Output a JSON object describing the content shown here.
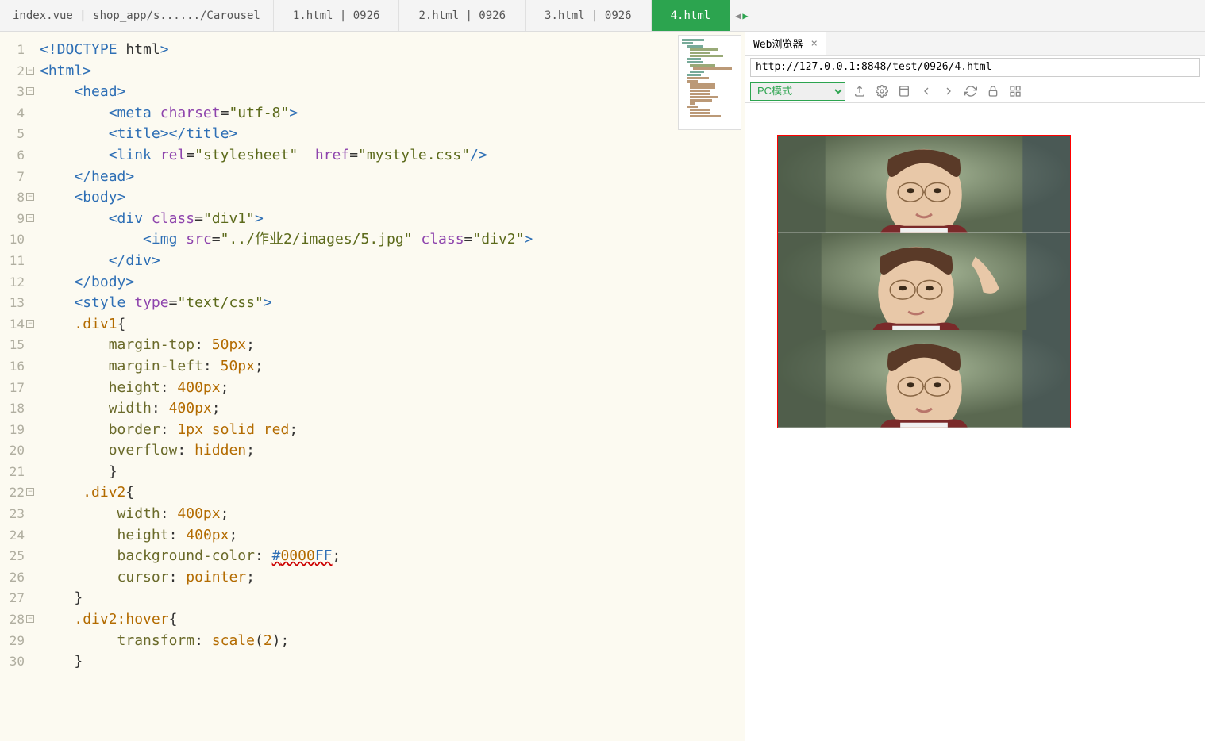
{
  "tabs": [
    "index.vue | shop_app/s....../Carousel",
    "1.html | 0926",
    "2.html | 0926",
    "3.html | 0926",
    "4.html"
  ],
  "active_tab": 4,
  "browser": {
    "tab_label": "Web浏览器",
    "url": "http://127.0.0.1:8848/test/0926/4.html",
    "mode": "PC模式"
  },
  "code": {
    "lines": [
      {
        "num": 1,
        "fold": false,
        "segs": [
          [
            "ctag",
            "<!DOCTYPE"
          ],
          [
            "",
            ""
          ],
          [
            "",
            ""
          ],
          [
            "",
            ""
          ],
          [
            "",
            ""
          ]
        ],
        "raw": "<!DOCTYPE html>"
      },
      {
        "num": 2,
        "fold": true,
        "raw": "<html>"
      },
      {
        "num": 3,
        "fold": true,
        "raw": "    <head>"
      },
      {
        "num": 4,
        "fold": false,
        "raw": "        <meta charset=\"utf-8\">"
      },
      {
        "num": 5,
        "fold": false,
        "raw": "        <title></title>"
      },
      {
        "num": 6,
        "fold": false,
        "raw": "        <link rel=\"stylesheet\"  href=\"mystyle.css\"/>"
      },
      {
        "num": 7,
        "fold": false,
        "raw": "    </head>"
      },
      {
        "num": 8,
        "fold": true,
        "raw": "    <body>"
      },
      {
        "num": 9,
        "fold": true,
        "raw": "        <div class=\"div1\">"
      },
      {
        "num": 10,
        "fold": false,
        "raw": "            <img src=\"../作业2/images/5.jpg\" class=\"div2\">"
      },
      {
        "num": 11,
        "fold": false,
        "raw": "        </div>"
      },
      {
        "num": 12,
        "fold": false,
        "raw": "    </body>"
      },
      {
        "num": 13,
        "fold": false,
        "raw": "    <style type=\"text/css\">"
      },
      {
        "num": 14,
        "fold": true,
        "raw": "    .div1{"
      },
      {
        "num": 15,
        "fold": false,
        "raw": "        margin-top: 50px;"
      },
      {
        "num": 16,
        "fold": false,
        "raw": "        margin-left: 50px;"
      },
      {
        "num": 17,
        "fold": false,
        "raw": "        height:400px;"
      },
      {
        "num": 18,
        "fold": false,
        "raw": "        width: 400px;"
      },
      {
        "num": 19,
        "fold": false,
        "raw": "        border: 1px solid red;"
      },
      {
        "num": 20,
        "fold": false,
        "raw": "        overflow: hidden;"
      },
      {
        "num": 21,
        "fold": false,
        "raw": "        }"
      },
      {
        "num": 22,
        "fold": true,
        "raw": "     .div2{"
      },
      {
        "num": 23,
        "fold": false,
        "raw": "         width: 400px;"
      },
      {
        "num": 24,
        "fold": false,
        "raw": "         height: 400px;"
      },
      {
        "num": 25,
        "fold": false,
        "raw": "         background-color: #0000FF;"
      },
      {
        "num": 26,
        "fold": false,
        "raw": "         cursor: pointer;"
      },
      {
        "num": 27,
        "fold": false,
        "raw": "    }"
      },
      {
        "num": 28,
        "fold": true,
        "raw": "    .div2:hover{"
      },
      {
        "num": 29,
        "fold": false,
        "raw": "         transform: scale(2);"
      },
      {
        "num": 30,
        "fold": false,
        "raw": "    }"
      }
    ]
  }
}
